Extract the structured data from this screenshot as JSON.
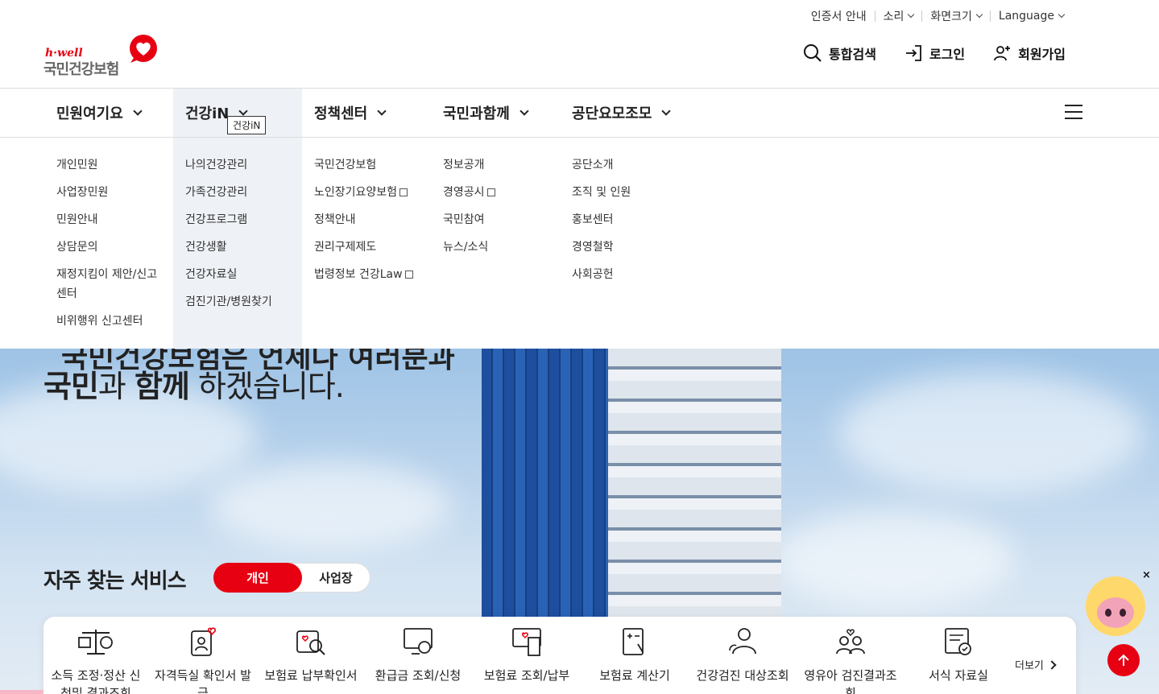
{
  "util": [
    "인증서 안내",
    "소리",
    "화면크기",
    "Language"
  ],
  "logo": {
    "tagline": "h·well",
    "name": "국민건강보험"
  },
  "actions": {
    "search": "통합검색",
    "login": "로그인",
    "join": "회원가입"
  },
  "gnb": [
    "민원여기요",
    "건강iN",
    "정책센터",
    "국민과함께",
    "공단요모조모"
  ],
  "tooltip": "건강iN",
  "dropdown": [
    [
      "개인민원",
      "사업장민원",
      "민원안내",
      "상담문의",
      "재정지킴이 제안/신고센터",
      "비위행위 신고센터"
    ],
    [
      "나의건강관리",
      "가족건강관리",
      "건강프로그램",
      "건강생활",
      "건강자료실",
      "검진기관/병원찾기"
    ],
    [
      "국민건강보험",
      "노인장기요양보험",
      "정책안내",
      "권리구제제도",
      "법령정보 건강Law"
    ],
    [
      "정보공개",
      "경영공시",
      "국민참여",
      "뉴스/소식"
    ],
    [
      "공단소개",
      "조직 및 인원",
      "홍보센터",
      "경영철학",
      "사회공헌"
    ]
  ],
  "hero": {
    "cut_line": "국민건강보험은 언제나 여러분과",
    "h_bold1": "국민",
    "h_mid": "과 ",
    "h_bold2": "함께",
    "h_end": " 하겠습니다."
  },
  "services_title": "자주 찾는 서비스",
  "toggle": {
    "on": "개인",
    "off": "사업장"
  },
  "services": [
    "소득 조정·정산 신청및 결과조회",
    "자격득실 확인서 발급",
    "보험료 납부확인서",
    "환급금 조회/신청",
    "보험료 조회/납부",
    "보험료 계산기",
    "건강검진 대상조회",
    "영유아 검진결과조회",
    "서식 자료실"
  ],
  "more": "더보기",
  "close": "×",
  "colors": {
    "brand": "#e60012",
    "gnb_active": "#eef1f5"
  }
}
